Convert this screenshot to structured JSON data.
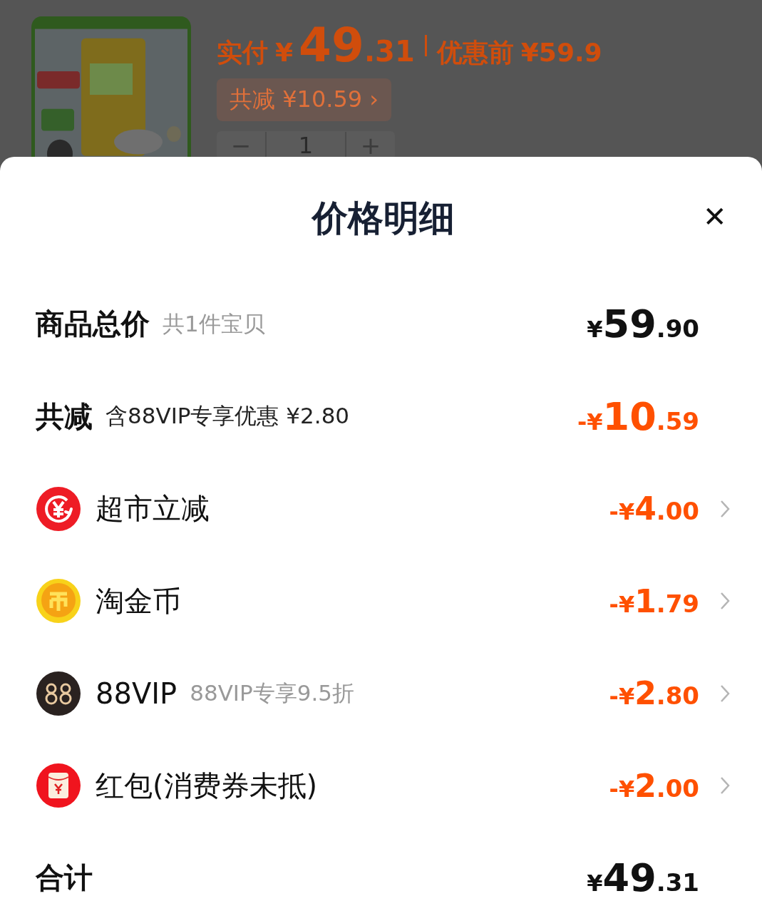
{
  "product": {
    "paid_label": "实付",
    "paid_currency": "¥",
    "paid_major": "49",
    "paid_minor": ".31",
    "original_label": "优惠前",
    "original_price": "¥59.9",
    "discount_tag": "共减 ¥10.59",
    "discount_chevron": "›",
    "quantity": {
      "minus": "−",
      "value": "1",
      "plus": "+"
    }
  },
  "sheet": {
    "title": "价格明细",
    "close": "✕",
    "rows": [
      {
        "kind": "plain",
        "label": "商品总价",
        "note": "共1件宝贝",
        "note_muted": true,
        "discount": false,
        "prefix": "¥",
        "major": "59",
        "minor": ".90",
        "expandable": false
      },
      {
        "kind": "plain",
        "label": "共减",
        "note": "含88VIP专享优惠 ¥2.80",
        "note_muted": false,
        "discount": true,
        "prefix": "-¥",
        "major": "10",
        "minor": ".59",
        "expandable": false
      },
      {
        "kind": "instant",
        "label": "超市立减",
        "discount": true,
        "prefix": "-¥",
        "major": "4",
        "minor": ".00",
        "expandable": true
      },
      {
        "kind": "coin",
        "label": "淘金币",
        "discount": true,
        "prefix": "-¥",
        "major": "1",
        "minor": ".79",
        "expandable": true
      },
      {
        "kind": "vip",
        "label": "88VIP",
        "note": "88VIP专享9.5折",
        "note_muted": true,
        "discount": true,
        "prefix": "-¥",
        "major": "2",
        "minor": ".80",
        "expandable": true
      },
      {
        "kind": "packet",
        "label": "红包(消费券未抵)",
        "discount": true,
        "prefix": "-¥",
        "major": "2",
        "minor": ".00",
        "expandable": true
      },
      {
        "kind": "plain",
        "label": "合计",
        "discount": false,
        "prefix": "¥",
        "major": "49",
        "minor": ".31",
        "expandable": false
      }
    ]
  }
}
